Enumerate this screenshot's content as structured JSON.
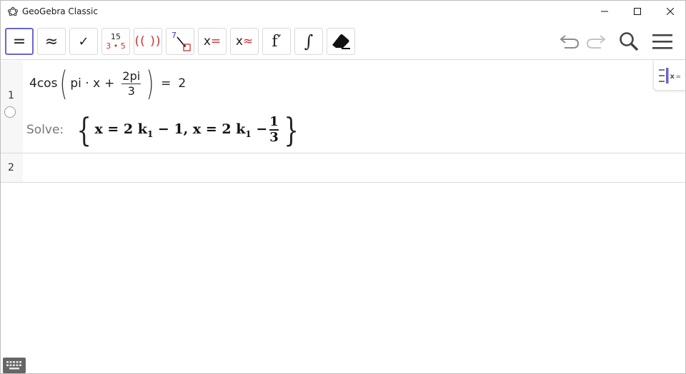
{
  "window": {
    "title": "GeoGebra Classic"
  },
  "toolbar": {
    "evaluate_symbol": "=",
    "numeric_symbol": "≈",
    "keep_input_symbol": "✓",
    "factor_top": "15",
    "factor_bottom": "3 • 5",
    "expand_symbol": "(( ))",
    "substitute_symbol": "7",
    "solve_x": "x",
    "solve_eq": "=",
    "nsolve_x": "x",
    "nsolve_approx": "≈",
    "derivative_symbol": "f′",
    "integral_symbol": "∫"
  },
  "algebra": {
    "row1": {
      "number": "1",
      "input": {
        "coeff_func": "4cos",
        "term1": "pi · x",
        "plus": "+",
        "frac_num": "2pi",
        "frac_den": "3",
        "equals": "=",
        "rhs": "2"
      },
      "output": {
        "label": "Solve:",
        "part1": "x = 2 k",
        "sub1": "1",
        "part2": " − 1, x = 2 k",
        "sub2": "1",
        "part3": " −",
        "frac_num": "1",
        "frac_den": "3"
      }
    },
    "row2": {
      "number": "2",
      "input": ""
    }
  },
  "colors": {
    "accent": "#6a66cc",
    "red": "#d32f2f"
  }
}
